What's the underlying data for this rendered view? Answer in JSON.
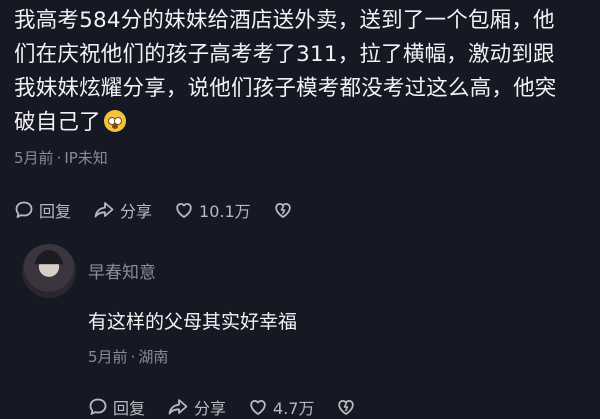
{
  "post": {
    "lines": [
      "我高考584分的妹妹给酒店送外卖，送到了一个包厢，他",
      "们在庆祝他们的孩子高考考了311，拉了横幅，激动到跟",
      "我妹妹炫耀分享，说他们孩子模考都没考过这么高，他突",
      "破自己了"
    ],
    "emoji": "astonished-face-emoji",
    "meta": {
      "time": "5月前",
      "location": "IP未知"
    },
    "actions": {
      "reply": "回复",
      "share": "分享",
      "likes": "10.1万"
    }
  },
  "reply": {
    "username": "早春知意",
    "text": "有这样的父母其实好幸福",
    "meta": {
      "time": "5月前",
      "location": "湖南"
    },
    "actions": {
      "reply": "回复",
      "share": "分享",
      "likes": "4.7万"
    }
  },
  "colors": {
    "background": "#161823",
    "text": "#f2f2f4",
    "muted": "#8a8b93"
  }
}
